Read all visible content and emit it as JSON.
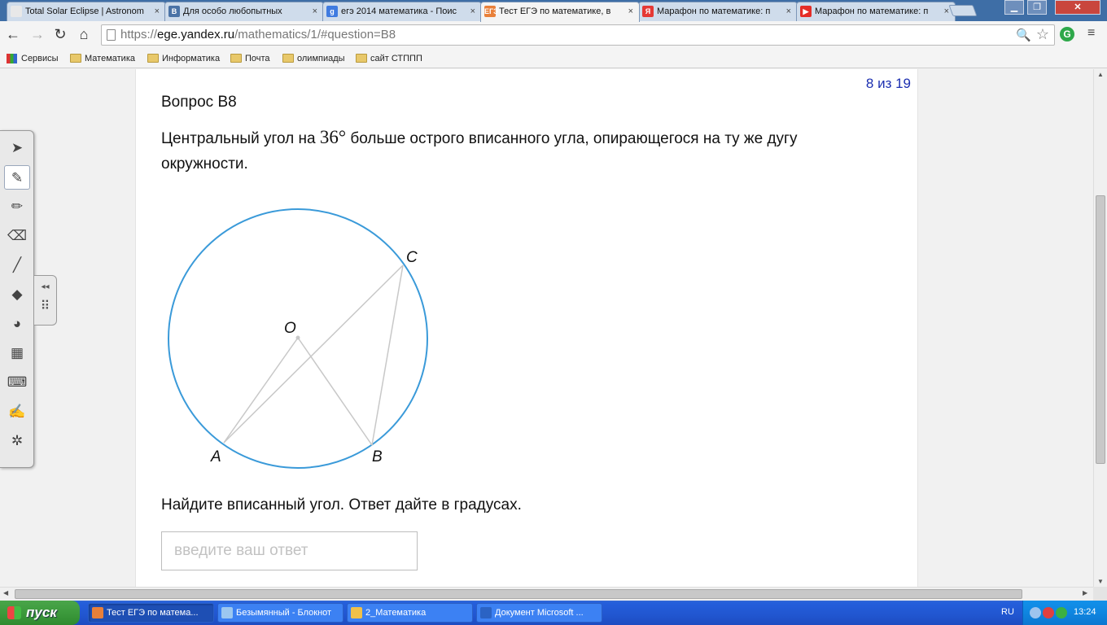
{
  "tabs": [
    {
      "title": "Total Solar Eclipse | Astronom",
      "fav": "",
      "fav_color": "#e8e8e8",
      "active": false
    },
    {
      "title": "Для особо любопытных",
      "fav": "В",
      "fav_color": "#4b73a6",
      "active": false
    },
    {
      "title": "егэ 2014 математика - Поис",
      "fav": "g",
      "fav_color": "#3f7be0",
      "active": false
    },
    {
      "title": "Тест ЕГЭ по математике, в",
      "fav": "ЕГЭ",
      "fav_color": "#e9803a",
      "active": true
    },
    {
      "title": "Марафон по математике: п",
      "fav": "Я",
      "fav_color": "#e53935",
      "active": false
    },
    {
      "title": "Марафон по математике: п",
      "fav": "▶",
      "fav_color": "#e52d27",
      "active": false
    }
  ],
  "tab_close_glyph": "×",
  "window_controls": {
    "minimize": "▁",
    "maximize": "❐",
    "close": "✕"
  },
  "toolbar": {
    "back": "←",
    "forward": "→",
    "reload": "↻",
    "home": "⌂",
    "url_scheme": "https://",
    "url_host": "ege.yandex.ru",
    "url_path": "/mathematics/1/#question=B8",
    "zoom_glyph": "🔍",
    "star_glyph": "☆",
    "menu_glyph": "≡",
    "ext_glyph": "G"
  },
  "bookmarks": [
    "Сервисы",
    "Математика",
    "Информатика",
    "Почта",
    "олимпиады",
    "сайт СТППП"
  ],
  "question": {
    "counter": "8 из 19",
    "title": "Вопрос B8",
    "text_before": "Центральный угол на ",
    "degree_value": "36°",
    "text_after": " больше острого вписанного угла, опирающегося на ту же дугу окружности.",
    "task": "Найдите вписанный угол. Ответ дайте в градусах.",
    "answer_placeholder": "введите ваш ответ",
    "answer_value": ""
  },
  "figure": {
    "circle_color": "#3a9ad9",
    "line_color": "#c8c8c8",
    "labels": {
      "O": "O",
      "A": "A",
      "B": "B",
      "C": "C"
    }
  },
  "sidetools": [
    {
      "name": "select-tool",
      "glyph": "➤",
      "active": false
    },
    {
      "name": "pen-tool",
      "glyph": "✎",
      "active": true
    },
    {
      "name": "highlighter-tool",
      "glyph": "✏",
      "active": false
    },
    {
      "name": "eraser-tool",
      "glyph": "⌫",
      "active": false
    },
    {
      "name": "line-tool",
      "glyph": "╱",
      "active": false
    },
    {
      "name": "shapes-tool",
      "glyph": "◆",
      "active": false
    },
    {
      "name": "fill-tool",
      "glyph": "◕",
      "active": false
    },
    {
      "name": "calculator-tool",
      "glyph": "▦",
      "active": false
    },
    {
      "name": "keyboard-tool",
      "glyph": "⌨",
      "active": false
    },
    {
      "name": "notes-tool",
      "glyph": "✍",
      "active": false
    },
    {
      "name": "settings-tool",
      "glyph": "✲",
      "active": false
    }
  ],
  "sidehandle": {
    "collapse": "◂◂",
    "grip": "⠿"
  },
  "taskbar": {
    "start": "пуск",
    "items": [
      {
        "label": "Тест ЕГЭ по матема...",
        "color": "#e9803a",
        "active": true
      },
      {
        "label": "Безымянный - Блокнот",
        "color": "#9cc7f0",
        "active": false
      },
      {
        "label": "2_Математика",
        "color": "#f0c04a",
        "active": false
      },
      {
        "label": "Документ Microsoft ...",
        "color": "#2b63c4",
        "active": false
      }
    ],
    "lang": "RU",
    "clock": "13:24"
  }
}
